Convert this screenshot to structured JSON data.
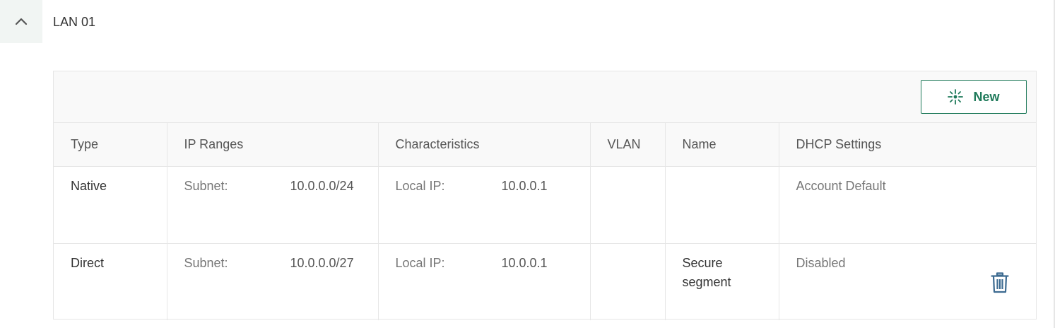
{
  "section": {
    "title": "LAN 01",
    "toggle_icon": "chevron-up-icon"
  },
  "toolbar": {
    "new_label": "New",
    "new_icon": "sparkle-icon"
  },
  "colors": {
    "accent": "#1f7a5a",
    "trash": "#3d6b91",
    "header_bg": "#f9f9f9",
    "toggle_bg": "#f1f5f3"
  },
  "table": {
    "columns": [
      "Type",
      "IP Ranges",
      "Characteristics",
      "VLAN",
      "Name",
      "DHCP Settings"
    ],
    "rows": [
      {
        "type": "Native",
        "subnet_label": "Subnet:",
        "subnet_value": "10.0.0.0/24",
        "local_ip_label": "Local IP:",
        "local_ip_value": "10.0.0.1",
        "vlan": "",
        "name": "",
        "dhcp": "Account Default",
        "deletable": false
      },
      {
        "type": "Direct",
        "subnet_label": "Subnet:",
        "subnet_value": "10.0.0.0/27",
        "local_ip_label": "Local IP:",
        "local_ip_value": "10.0.0.1",
        "vlan": "",
        "name": "Secure segment",
        "dhcp": "Disabled",
        "deletable": true,
        "delete_icon": "trash-icon"
      }
    ]
  }
}
